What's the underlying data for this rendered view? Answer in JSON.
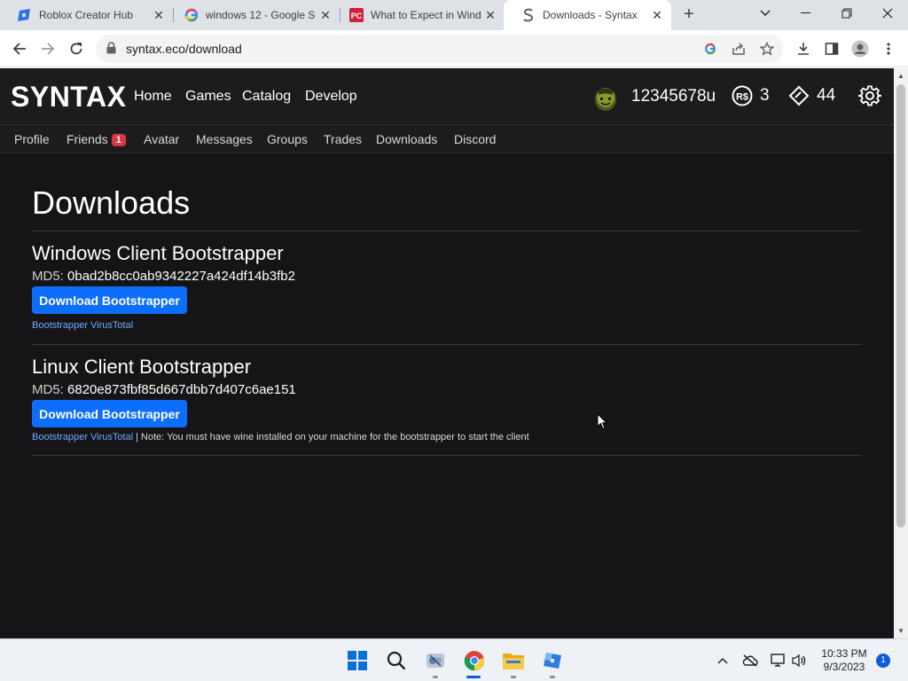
{
  "browser": {
    "tabs": [
      {
        "title": "Roblox Creator Hub",
        "icon": "roblox-studio-icon"
      },
      {
        "title": "windows 12 - Google S",
        "icon": "google-icon"
      },
      {
        "title": "What to Expect in Wind",
        "icon": "pcmag-icon"
      },
      {
        "title": "Downloads - Syntax",
        "icon": "syntax-icon",
        "active": true
      }
    ],
    "url": "syntax.eco/download"
  },
  "site": {
    "brand": "SYNTAX",
    "nav": [
      "Home",
      "Games",
      "Catalog",
      "Develop"
    ],
    "username": "12345678u",
    "robux": "3",
    "tix": "44",
    "subnav": {
      "profile": "Profile",
      "friends": "Friends",
      "friends_badge": "1",
      "avatar": "Avatar",
      "messages": "Messages",
      "groups": "Groups",
      "trades": "Trades",
      "downloads": "Downloads",
      "discord": "Discord"
    },
    "page_title": "Downloads",
    "downloads": [
      {
        "title": "Windows Client Bootstrapper",
        "md5_label": "MD5:",
        "md5": "0bad2b8cc0ab9342227a424df14b3fb2",
        "button": "Download Bootstrapper",
        "link": "Bootstrapper VirusTotal",
        "note": ""
      },
      {
        "title": "Linux Client Bootstrapper",
        "md5_label": "MD5:",
        "md5": "6820e873fbf85d667dbb7d407c6ae151",
        "button": "Download Bootstrapper",
        "link": "Bootstrapper VirusTotal",
        "note": "| Note: You must have wine installed on your machine for the bootstrapper to start the client"
      }
    ]
  },
  "taskbar": {
    "time": "10:33 PM",
    "date": "9/3/2023",
    "notifications": "1"
  },
  "colors": {
    "accent": "#0d6efd",
    "link": "#6ea8fe",
    "background": "#151517",
    "badge": "#dc3545"
  }
}
